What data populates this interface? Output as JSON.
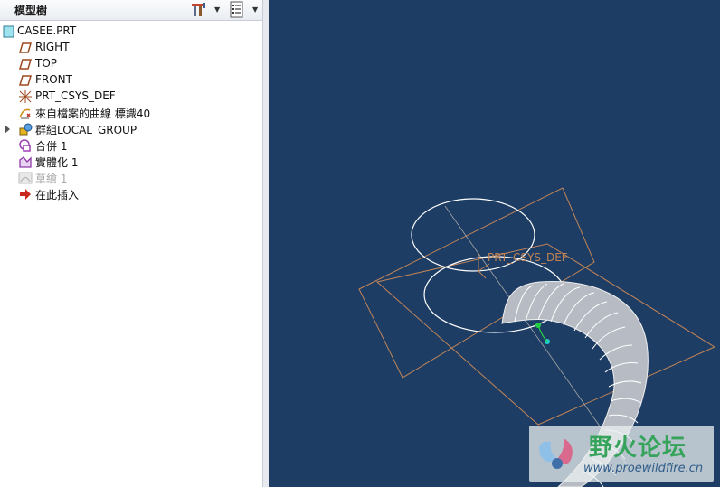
{
  "panel": {
    "title": "模型樹",
    "settings_icon": "tree-settings-icon",
    "columns_icon": "tree-columns-icon"
  },
  "tree": {
    "items": [
      {
        "label": "CASEE.PRT",
        "icon": "part-icon"
      },
      {
        "label": "RIGHT",
        "icon": "datum-plane-icon"
      },
      {
        "label": "TOP",
        "icon": "datum-plane-icon"
      },
      {
        "label": "FRONT",
        "icon": "datum-plane-icon"
      },
      {
        "label": "PRT_CSYS_DEF",
        "icon": "csys-icon"
      },
      {
        "label": "來自檔案的曲線 標識40",
        "icon": "curve-from-file-icon"
      },
      {
        "label": "群組LOCAL_GROUP",
        "icon": "group-icon"
      },
      {
        "label": "合併 1",
        "icon": "merge-icon"
      },
      {
        "label": "實體化 1",
        "icon": "solidify-icon"
      },
      {
        "label": "草繪 1",
        "icon": "sketch-icon"
      },
      {
        "label": "在此插入",
        "icon": "insert-here-icon"
      }
    ]
  },
  "viewport": {
    "csys_label": "PRT_CSYS_DEF",
    "background": "#1e3d64",
    "datum_color": "#c08457",
    "curve_color": "#ffffff"
  },
  "watermark": {
    "title": "野火论坛",
    "url": "www.proewildfire.cn"
  }
}
